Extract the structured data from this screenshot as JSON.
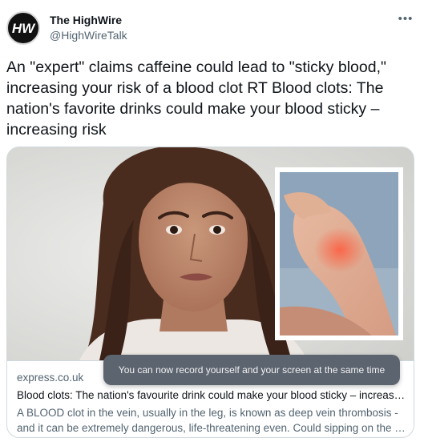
{
  "account": {
    "display_name": "The HighWire",
    "handle": "@HighWireTalk",
    "avatar_label": "HW"
  },
  "tweet": {
    "text": "An \"expert\" claims caffeine could lead to \"sticky blood,\"  increasing your risk of a blood clot RT Blood clots: The nation's favorite drinks could make your blood sticky – increasing risk"
  },
  "link_card": {
    "domain": "express.co.uk",
    "title": "Blood clots: The nation's favourite drink could make your blood sticky – increas…",
    "description": "A BLOOD clot in the vein, usually in the leg, is known as deep vein thrombosis - and it can be extremely dangerous, life-threatening even. Could sipping on the …"
  },
  "toast": {
    "message": "You can now record yourself and your screen at the same time"
  },
  "icons": {
    "more": "more-horizontal-icon"
  },
  "colors": {
    "text_primary": "#0f1419",
    "text_secondary": "#536471",
    "border": "#cfd9de",
    "toast_bg": "#5c6470"
  }
}
